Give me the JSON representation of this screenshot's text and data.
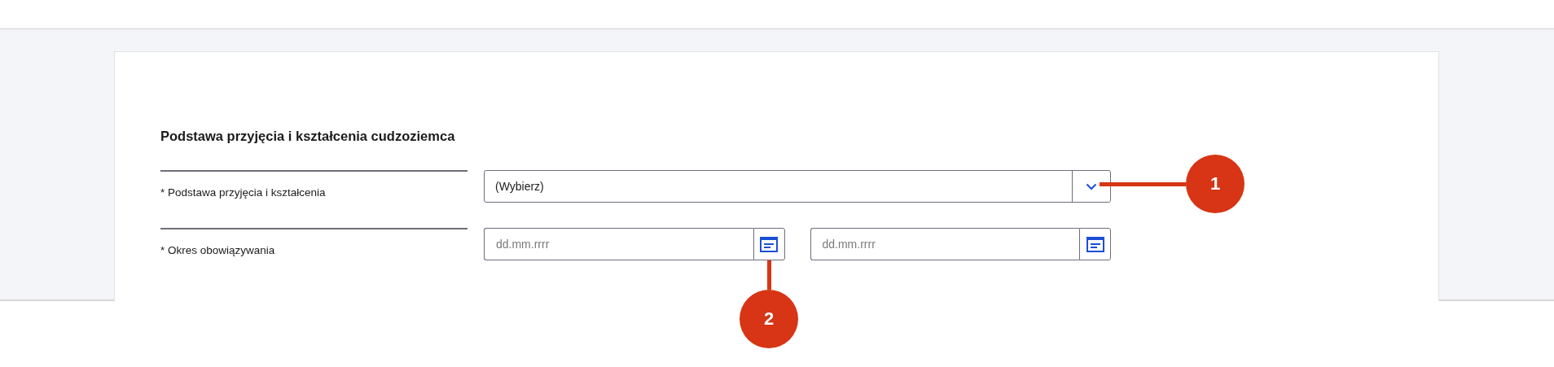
{
  "section": {
    "title": "Podstawa przyjęcia i kształcenia cudzoziemca"
  },
  "fields": [
    {
      "kind": "select",
      "label": "* Podstawa przyjęcia i kształcenia",
      "value": "(Wybierz)"
    },
    {
      "kind": "date_range",
      "label": "* Okres obowiązywania",
      "inputs": [
        {
          "placeholder": "dd.mm.rrrr"
        },
        {
          "placeholder": "dd.mm.rrrr"
        }
      ]
    }
  ],
  "callouts": [
    {
      "label": "1"
    },
    {
      "label": "2"
    }
  ]
}
